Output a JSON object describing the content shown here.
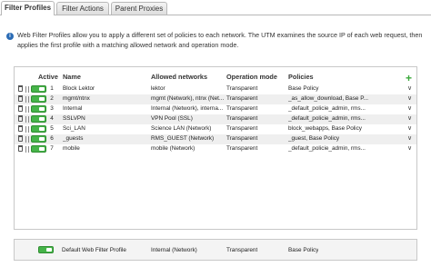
{
  "tabs": [
    {
      "label": "Filter Profiles",
      "active": true
    },
    {
      "label": "Filter Actions",
      "active": false
    },
    {
      "label": "Parent Proxies",
      "active": false
    }
  ],
  "info": {
    "text": "Web Filter Profiles allow you to apply a different set of policies to each network. The UTM examines the source IP of each web request, then applies the first profile with a matching allowed network and operation mode."
  },
  "table": {
    "columns": {
      "active": "Active",
      "name": "Name",
      "networks": "Allowed networks",
      "mode": "Operation mode",
      "policies": "Policies"
    },
    "rows": [
      {
        "num": "1",
        "name": "Block Lektor",
        "networks": "lektor",
        "mode": "Transparent",
        "policies": "Base Policy"
      },
      {
        "num": "2",
        "name": "mgmt/ntnx",
        "networks": "mgmt (Network), ntnx (Net...",
        "mode": "Transparent",
        "policies": "_as_allow_download, Base P..."
      },
      {
        "num": "3",
        "name": "Internal",
        "networks": "Internal (Network), interna...",
        "mode": "Transparent",
        "policies": "_default_policie_admin, rms..."
      },
      {
        "num": "4",
        "name": "SSLVPN",
        "networks": "VPN Pool (SSL)",
        "mode": "Transparent",
        "policies": "_default_policie_admin, rms..."
      },
      {
        "num": "5",
        "name": "Sci_LAN",
        "networks": "Science LAN (Network)",
        "mode": "Transparent",
        "policies": "block_webapps, Base Policy"
      },
      {
        "num": "6",
        "name": "_guests",
        "networks": "RMS_GUEST (Network)",
        "mode": "Transparent",
        "policies": "_guest, Base Policy"
      },
      {
        "num": "7",
        "name": "mobile",
        "networks": "mobile (Network)",
        "mode": "Transparent",
        "policies": "_default_policie_admin, rms..."
      }
    ]
  },
  "default_profile": {
    "name": "Default Web Filter Profile",
    "networks": "Internal (Network)",
    "mode": "Transparent",
    "policies": "Base Policy"
  },
  "colors": {
    "toggle_on": "#46b449",
    "add": "#3aa83a",
    "info_icon": "#2b6cb5"
  },
  "icons": [
    "trash-icon",
    "drag-handle-icon",
    "info-icon",
    "add-icon",
    "chevron-down-icon"
  ]
}
